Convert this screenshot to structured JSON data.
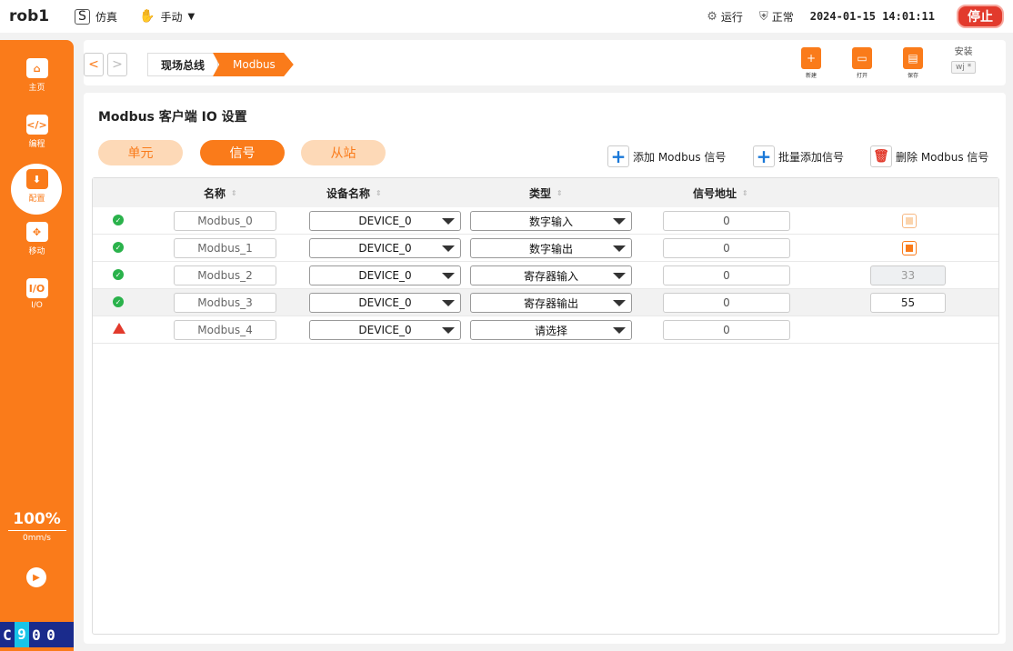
{
  "topbar": {
    "robot_name": "rob1",
    "sim_icon_text": "S",
    "sim_label": "仿真",
    "mode_label": "手动",
    "run_label": "运行",
    "normal_label": "正常",
    "datetime": "2024-01-15 14:01:11",
    "stop_label": "停止"
  },
  "sidebar": {
    "items": [
      {
        "label": "主页",
        "icon": "home-icon",
        "glyph": "⌂"
      },
      {
        "label": "编程",
        "icon": "code-icon",
        "glyph": "</>"
      },
      {
        "label": "配置",
        "icon": "config-icon",
        "glyph": "⬇"
      },
      {
        "label": "移动",
        "icon": "move-icon",
        "glyph": "✥"
      },
      {
        "label": "I/O",
        "icon": "io-icon",
        "glyph": "I/O"
      }
    ],
    "speed_percent": "100%",
    "speed_unit": "0mm/s",
    "play_glyph": "▶",
    "counter": [
      "C",
      "9",
      "0",
      "0"
    ]
  },
  "breadcrumb": {
    "back": "<",
    "forward": ">",
    "parent": "现场总线",
    "current": "Modbus"
  },
  "file_tools": {
    "new_label": "新建",
    "open_label": "打开",
    "save_label": "保存",
    "install_label": "安装",
    "install_value": "wj *"
  },
  "page": {
    "title": "Modbus 客户端 IO 设置",
    "tabs": [
      "单元",
      "信号",
      "从站"
    ],
    "actions": {
      "add_signal": "添加 Modbus 信号",
      "batch_add": "批量添加信号",
      "delete_signal": "删除 Modbus 信号"
    }
  },
  "table": {
    "headers": {
      "name": "名称",
      "device": "设备名称",
      "type": "类型",
      "address": "信号地址"
    },
    "sort_glyph": "⇕",
    "rows": [
      {
        "status": "ok",
        "name": "Modbus_0",
        "device": "DEVICE_0",
        "type": "数字输入",
        "address": "0",
        "value_kind": "checkbox",
        "checked": false,
        "value": ""
      },
      {
        "status": "ok",
        "name": "Modbus_1",
        "device": "DEVICE_0",
        "type": "数字输出",
        "address": "0",
        "value_kind": "checkbox",
        "checked": true,
        "value": ""
      },
      {
        "status": "ok",
        "name": "Modbus_2",
        "device": "DEVICE_0",
        "type": "寄存器输入",
        "address": "0",
        "value_kind": "readonly",
        "value": "33"
      },
      {
        "status": "ok",
        "name": "Modbus_3",
        "device": "DEVICE_0",
        "type": "寄存器输出",
        "address": "0",
        "value_kind": "input",
        "value": "55"
      },
      {
        "status": "warn",
        "name": "Modbus_4",
        "device": "DEVICE_0",
        "type": "请选择",
        "address": "0",
        "value_kind": "none",
        "value": ""
      }
    ]
  },
  "colors": {
    "accent": "#fa7b1a",
    "accent_light": "#fdd9b7",
    "stop": "#e23a2c",
    "ok": "#2ab24b",
    "counter_bg": "#1a2b8c",
    "counter_hl": "#18c4e8",
    "action_blue": "#1a78d8"
  }
}
